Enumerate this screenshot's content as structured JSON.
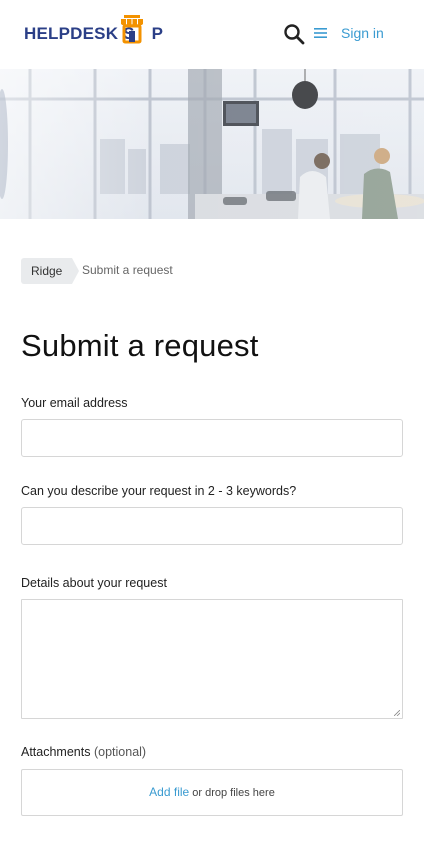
{
  "header": {
    "logo_text_part1": "HELPDESK S",
    "logo_text_part2": "P",
    "logo_alt": "HELPDESK SHOP",
    "signin_label": "Sign in"
  },
  "breadcrumbs": {
    "parent": "Ridge",
    "current": "Submit a request"
  },
  "form": {
    "title": "Submit a request",
    "email_label": "Your email address",
    "email_value": "",
    "keywords_label": "Can you describe your request in 2 - 3 keywords?",
    "keywords_value": "",
    "details_label": "Details about your request",
    "details_value": "",
    "attachments_label": "Attachments",
    "attachments_optional": "(optional)",
    "add_file_label": "Add file",
    "drop_text": "or drop files here"
  },
  "colors": {
    "brand_navy": "#2b3f87",
    "brand_orange": "#f39200",
    "link_blue": "#3a9bd1"
  },
  "icons": [
    "search-icon",
    "menu-icon",
    "shop-storefront-icon"
  ]
}
